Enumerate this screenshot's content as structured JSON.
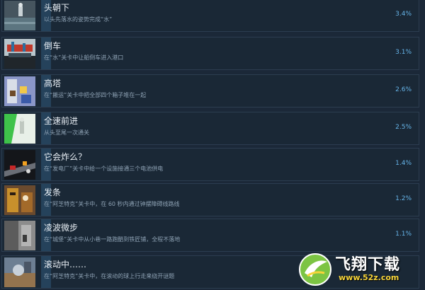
{
  "achievements": [
    {
      "title": "头朝下",
      "desc": "以头先落水的姿势完成“水”",
      "percent": "3.4%"
    },
    {
      "title": "倒车",
      "desc": "在“水”关卡中让船倒车进入港口",
      "percent": "3.1%"
    },
    {
      "title": "高塔",
      "desc": "在“搬运”关卡中把全部四个箱子堆在一起",
      "percent": "2.6%"
    },
    {
      "title": "全速前进",
      "desc": "从头至尾一次通关",
      "percent": "2.5%"
    },
    {
      "title": "它会炸么？",
      "desc": "在“发电厂”关卡中给一个设施接通三个电池供电",
      "percent": "1.4%"
    },
    {
      "title": "发条",
      "desc": "在“阿芝特克”关卡中，在 60 秒内通过钟摆障碍线路线",
      "percent": "1.2%"
    },
    {
      "title": "凌波微步",
      "desc": "在“城堡”关卡中从小巷一路跑酷到铁匠铺，全程不落地",
      "percent": "1.1%"
    },
    {
      "title": "滚动中……",
      "desc": "在“阿芝特克”关卡中，在滚动的球上行走来绕开谜题",
      "percent": ""
    }
  ],
  "watermark": {
    "brand": "飞翔下载",
    "url": "www.52z.com",
    "logo_icon": "fly-logo-icon"
  }
}
